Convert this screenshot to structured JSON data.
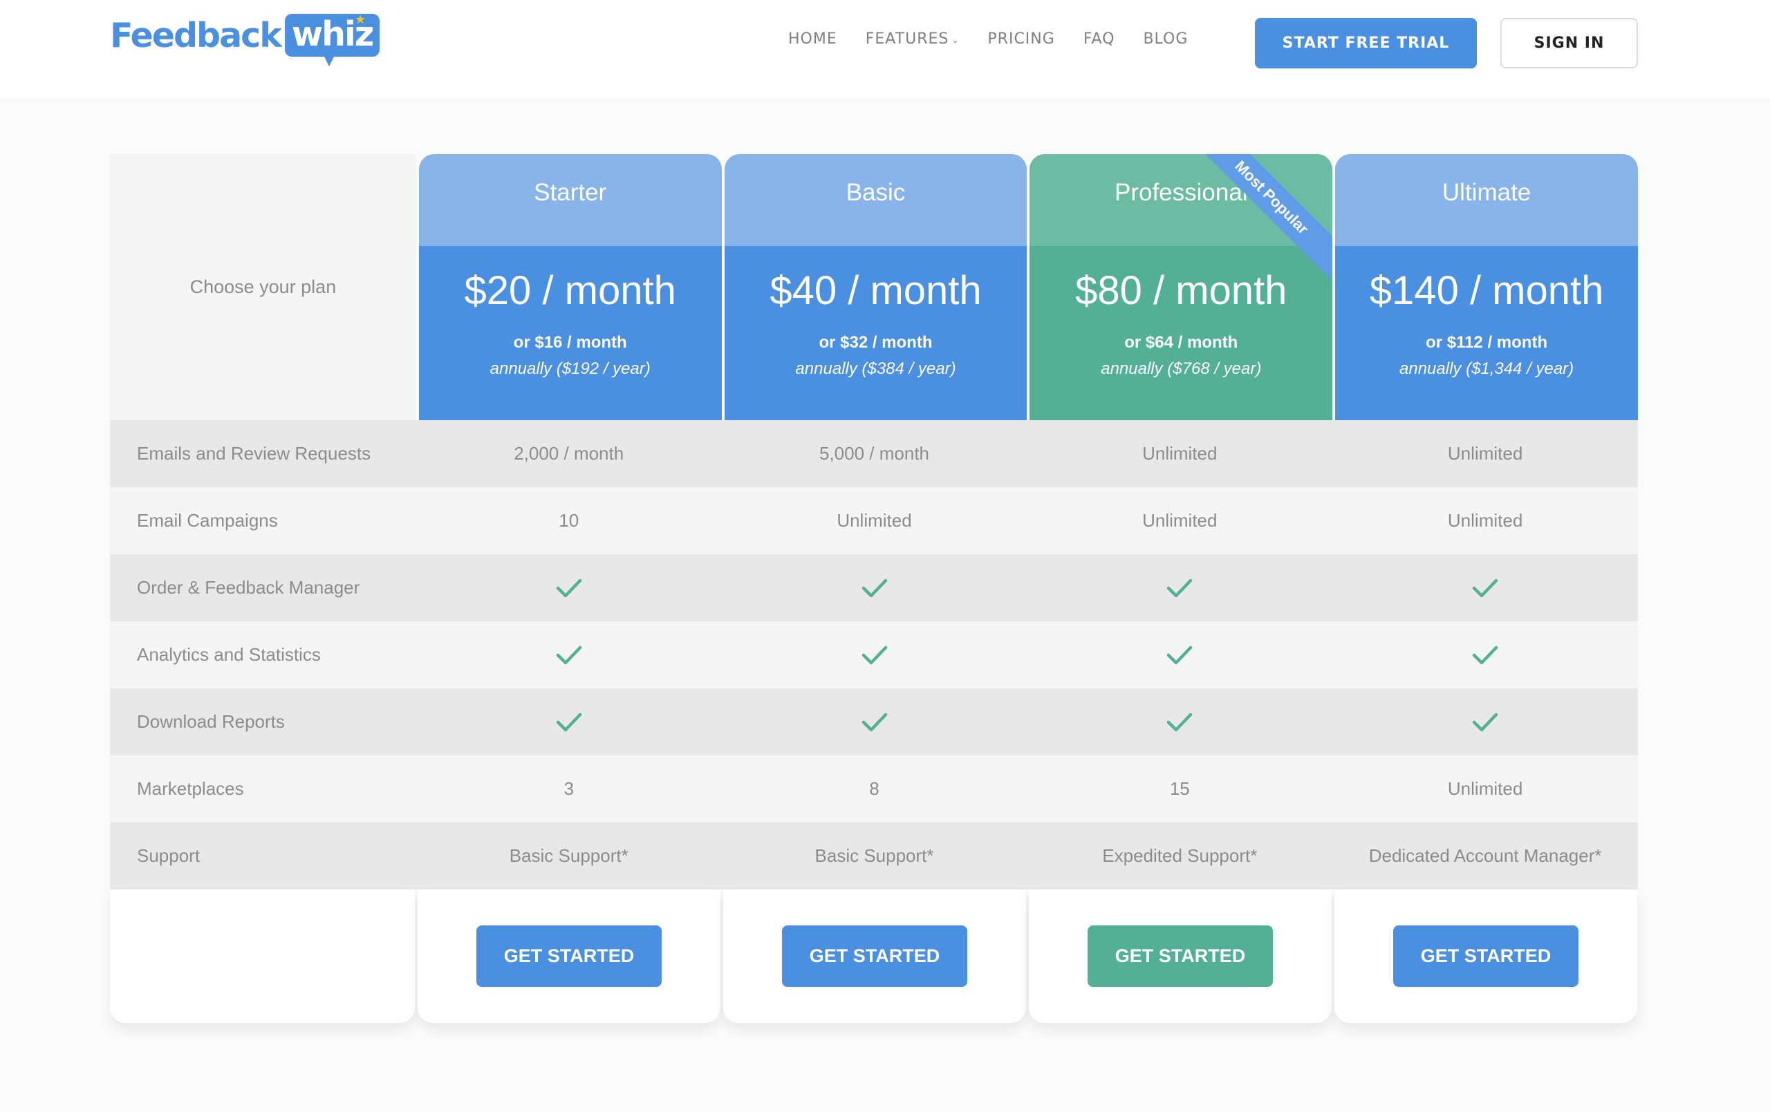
{
  "header": {
    "logo": {
      "text": "Feedback",
      "bubble": "whiz",
      "star_icon": "star-icon"
    },
    "nav": [
      {
        "label": "HOME"
      },
      {
        "label": "FEATURES",
        "has_dropdown": true
      },
      {
        "label": "PRICING"
      },
      {
        "label": "FAQ"
      },
      {
        "label": "BLOG"
      }
    ],
    "trial_button": "START FREE TRIAL",
    "signin_button": "SIGN IN"
  },
  "colors": {
    "primary_blue": "#4a8fe0",
    "light_blue": "#88b4ea",
    "primary_green": "#53b094",
    "light_green": "#6cbca4",
    "ribbon_blue": "#5f9be6",
    "check_green": "#53b094"
  },
  "pricing": {
    "choose_label": "Choose your plan",
    "plans": [
      {
        "name": "Starter",
        "price": "$20 / month",
        "annual_monthly": "or $16 / month",
        "annual_year": "annually ($192 / year)",
        "theme": "blue",
        "cta": "GET STARTED"
      },
      {
        "name": "Basic",
        "price": "$40 / month",
        "annual_monthly": "or $32 / month",
        "annual_year": "annually ($384 / year)",
        "theme": "blue",
        "cta": "GET STARTED"
      },
      {
        "name": "Professional",
        "price": "$80 / month",
        "annual_monthly": "or $64 / month",
        "annual_year": "annually ($768 / year)",
        "theme": "green",
        "badge": "Most Popular",
        "cta": "GET STARTED"
      },
      {
        "name": "Ultimate",
        "price": "$140 / month",
        "annual_monthly": "or $112 / month",
        "annual_year": "annually ($1,344 / year)",
        "theme": "blue",
        "cta": "GET STARTED"
      }
    ],
    "features": [
      {
        "label": "Emails and Review Requests",
        "values": [
          "2,000 / month",
          "5,000 / month",
          "Unlimited",
          "Unlimited"
        ]
      },
      {
        "label": "Email Campaigns",
        "values": [
          "10",
          "Unlimited",
          "Unlimited",
          "Unlimited"
        ]
      },
      {
        "label": "Order & Feedback Manager",
        "values": [
          true,
          true,
          true,
          true
        ]
      },
      {
        "label": "Analytics and Statistics",
        "values": [
          true,
          true,
          true,
          true
        ]
      },
      {
        "label": "Download Reports",
        "values": [
          true,
          true,
          true,
          true
        ]
      },
      {
        "label": "Marketplaces",
        "values": [
          "3",
          "8",
          "15",
          "Unlimited"
        ]
      },
      {
        "label": "Support",
        "values": [
          "Basic Support*",
          "Basic Support*",
          "Expedited Support*",
          "Dedicated Account Manager*"
        ]
      }
    ]
  }
}
